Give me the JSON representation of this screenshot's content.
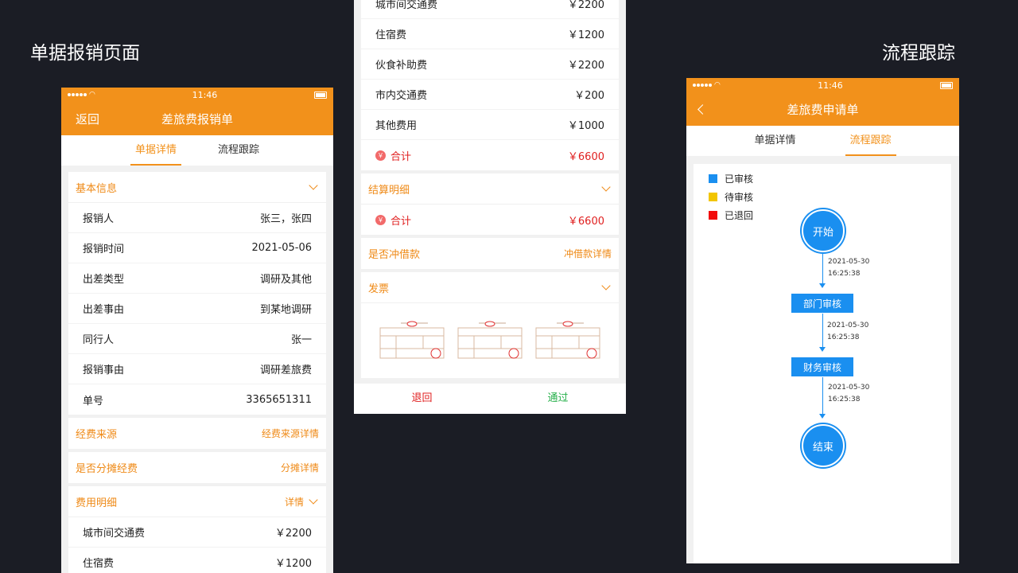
{
  "headings": {
    "left": "单据报销页面",
    "right": "流程跟踪"
  },
  "status_time": "11:46",
  "colors": {
    "orange": "#f2911b",
    "blue": "#1a8ff0",
    "yellow": "#f2c500",
    "red": "#f20c0c",
    "reject_red": "#e02020",
    "pass_green": "#27b04b"
  },
  "phone1": {
    "nav_back": "返回",
    "nav_title": "差旅费报销单",
    "tabs": [
      "单据详情",
      "流程跟踪"
    ],
    "basic_info": {
      "title": "基本信息",
      "rows": [
        {
          "label": "报销人",
          "value": "张三，张四"
        },
        {
          "label": "报销时间",
          "value": "2021-05-06"
        },
        {
          "label": "出差类型",
          "value": "调研及其他"
        },
        {
          "label": "出差事由",
          "value": "到某地调研"
        },
        {
          "label": "同行人",
          "value": "张一"
        },
        {
          "label": "报销事由",
          "value": "调研差旅费"
        },
        {
          "label": "单号",
          "value": "3365651311"
        }
      ]
    },
    "funding": {
      "title": "经费来源",
      "link": "经费来源详情"
    },
    "split": {
      "title": "是否分摊经费",
      "link": "分摊详情"
    },
    "expense": {
      "title": "费用明细",
      "link": "详情",
      "rows": [
        {
          "label": "城市间交通费",
          "value": "￥2200"
        },
        {
          "label": "住宿费",
          "value": "￥1200"
        }
      ]
    }
  },
  "phone2": {
    "expense_rows": [
      {
        "label": "城市间交通费",
        "value": "￥2200"
      },
      {
        "label": "住宿费",
        "value": "￥1200"
      },
      {
        "label": "伙食补助费",
        "value": "￥2200"
      },
      {
        "label": "市内交通费",
        "value": "￥200"
      },
      {
        "label": "其他费用",
        "value": "￥1000"
      }
    ],
    "total": {
      "label": "合计",
      "value": "￥6600"
    },
    "settlement": {
      "title": "结算明细",
      "total_label": "合计",
      "total_value": "￥6600"
    },
    "loan": {
      "title": "是否冲借款",
      "link": "冲借款详情"
    },
    "invoice": {
      "title": "发票"
    },
    "bottom": {
      "reject": "退回",
      "approve": "通过"
    }
  },
  "phone3": {
    "nav_title": "差旅费申请单",
    "tabs": [
      "单据详情",
      "流程跟踪"
    ],
    "legend": [
      {
        "label": "已审核",
        "color": "#1a8ff0"
      },
      {
        "label": "待审核",
        "color": "#f2c500"
      },
      {
        "label": "已退回",
        "color": "#f20c0c"
      }
    ],
    "flow": {
      "start": "开始",
      "step1": "部门审核",
      "step2": "财务审核",
      "end": "结束",
      "time1_date": "2021-05-30",
      "time1_clock": "16:25:38",
      "time2_date": "2021-05-30",
      "time2_clock": "16:25:38",
      "time3_date": "2021-05-30",
      "time3_clock": "16:25:38"
    }
  }
}
